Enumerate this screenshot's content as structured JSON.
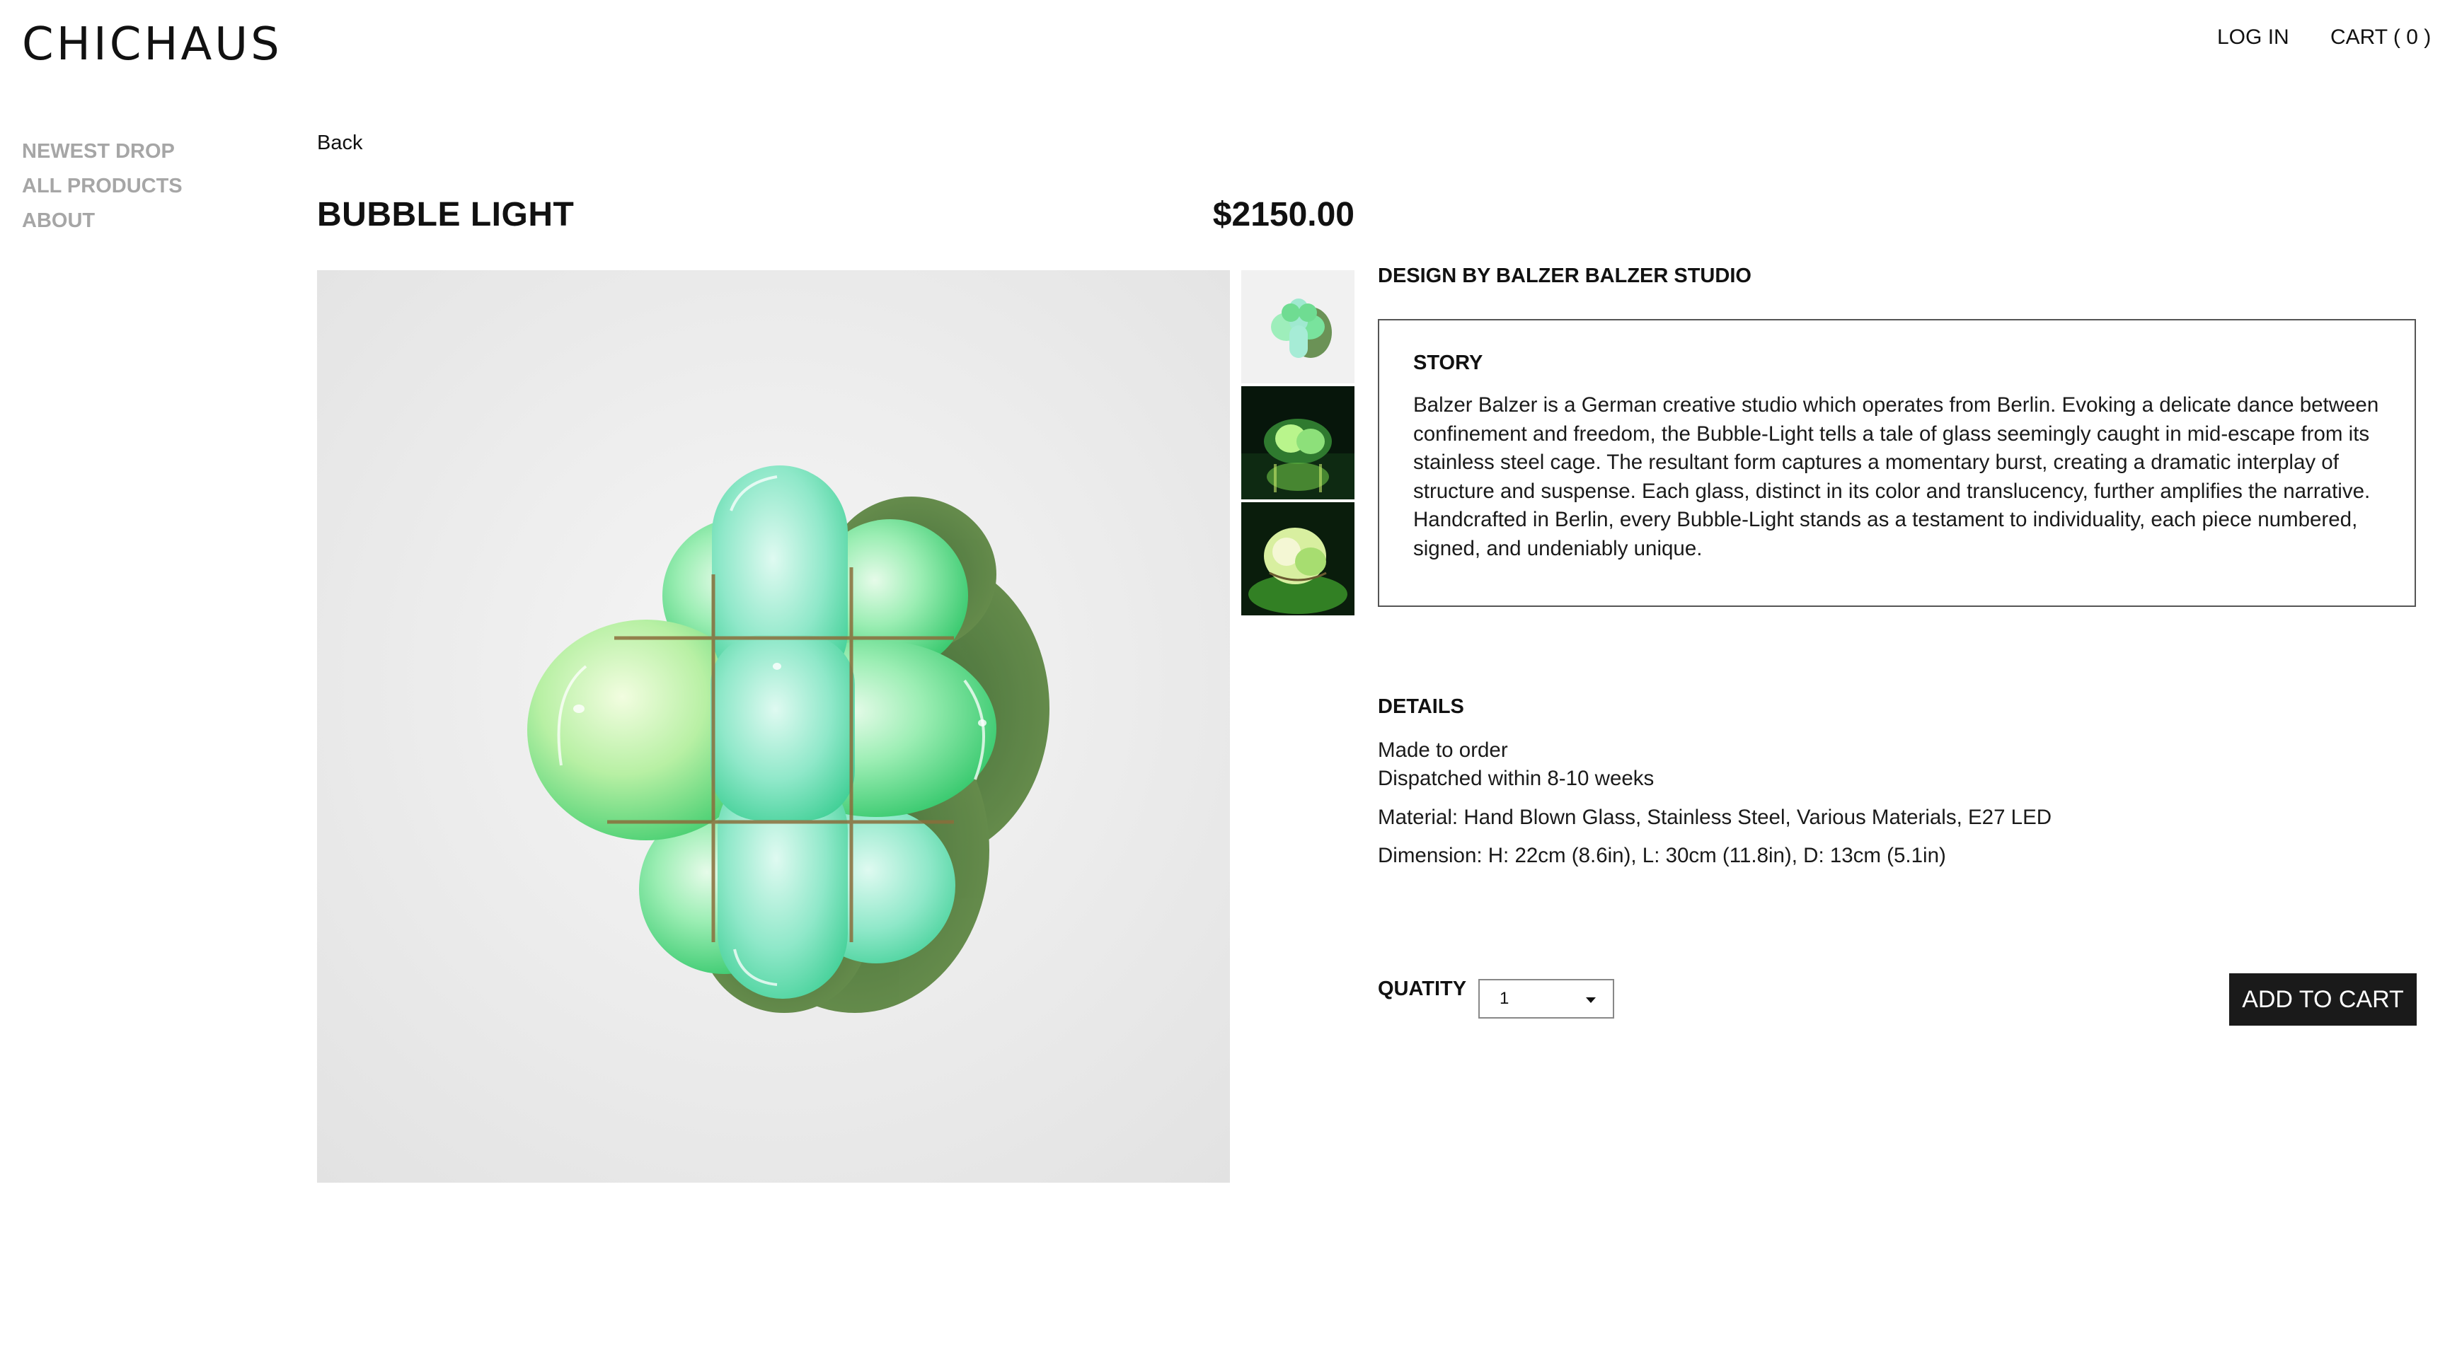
{
  "header": {
    "logo_text": "CHICHAUS",
    "login_label": "LOG IN",
    "cart_label": "CART ( 0 )"
  },
  "sidebar": {
    "items": [
      {
        "label": "NEWEST DROP"
      },
      {
        "label": "ALL PRODUCTS"
      },
      {
        "label": "ABOUT"
      }
    ]
  },
  "product": {
    "back_label": "Back",
    "title": "BUBBLE LIGHT",
    "price": "$2150.00",
    "designer": "DESIGN BY BALZER BALZER STUDIO",
    "main_image": "bubble-light-photo",
    "thumbnails": [
      "bubble-light-thumb-white",
      "bubble-light-thumb-dark-side",
      "bubble-light-thumb-dark-top"
    ]
  },
  "story": {
    "heading": "STORY",
    "text": "Balzer Balzer is a German creative studio which operates from Berlin. Evoking a delicate dance between confinement and freedom, the Bubble-Light tells a tale of glass seemingly caught in mid-escape from its stainless steel cage. The resultant form captures a momentary burst, creating a dramatic interplay of structure and suspense. Each glass, distinct in its color and translucency, further amplifies the narrative. Handcrafted in Berlin, every Bubble-Light stands as a testament to individuality, each piece numbered, signed, and undeniably unique."
  },
  "details": {
    "heading": "DETAILS",
    "lines": [
      "Made to order",
      "Dispatched within 8-10 weeks",
      "Material: Hand Blown Glass, Stainless Steel, Various Materials, E27 LED",
      "Dimension: H: 22cm (8.6in), L: 30cm (11.8in), D: 13cm (5.1in)"
    ]
  },
  "purchase": {
    "quantity_label": "QUATITY",
    "quantity_value": "1",
    "add_to_cart_label": "ADD TO CART"
  },
  "colors": {
    "sidebar_text": "#a6a6a6",
    "button_bg": "#1a1a1a",
    "glass_green": "#5fdc8a"
  }
}
